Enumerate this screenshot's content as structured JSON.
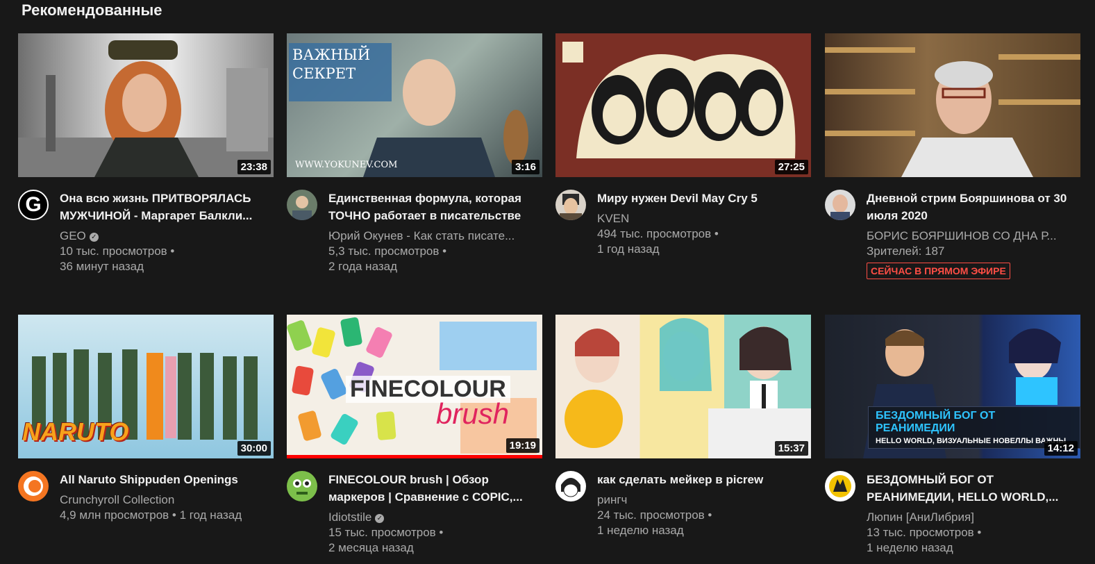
{
  "section": {
    "title": "Рекомендованные"
  },
  "videos": [
    {
      "title": "Она всю жизнь ПРИТВОРЯЛАСЬ МУЖЧИНОЙ - Маргарет Балкли...",
      "channel": "GEO",
      "views": "10 тыс. просмотров •",
      "age": "36 минут назад",
      "duration": "23:38",
      "verified": true,
      "avatar_icon": "G",
      "colors": [
        "#7a7a7a",
        "#cfcfcf",
        "#c2602a"
      ]
    },
    {
      "title": "Единственная формула, которая ТОЧНО работает в писательстве",
      "channel": "Юрий Окунев - Как стать писате...",
      "views": "5,3 тыс. просмотров •",
      "age": "2 года назад",
      "duration": "3:16",
      "thumb_text_1": "ВАЖНЫЙ",
      "thumb_text_2": "СЕКРЕТ",
      "thumb_caption": "WWW.YOKUNEV.COM",
      "colors": [
        "#5d6a6e",
        "#a7b3ad",
        "#2e6d9f"
      ]
    },
    {
      "title": "Миру нужен Devil May Cry 5",
      "channel": "KVEN",
      "views": "494 тыс. просмотров •",
      "age": "1 год назад",
      "duration": "27:25",
      "colors": [
        "#7a2f26",
        "#f2e7c8",
        "#1a1a1a"
      ]
    },
    {
      "title": "Дневной стрим Бояршинова от 30 июля 2020",
      "channel": "БОРИС БОЯРШИНОВ СО ДНА Р...",
      "viewers": "Зрителей: 187",
      "live": "СЕЙЧАС В ПРЯМОМ ЭФИРЕ",
      "colors": [
        "#5b4329",
        "#a57c4c",
        "#e0e0e0"
      ]
    },
    {
      "title": "All Naruto Shippuden Openings",
      "channel": "Crunchyroll Collection",
      "views_age": "4,9 млн просмотров • 1 год назад",
      "duration": "30:00",
      "thumb_logo": "NARUTO",
      "colors": [
        "#8fc7e0",
        "#cfe7f0",
        "#f08a1c"
      ]
    },
    {
      "title": "FINECOLOUR brush | Обзор маркеров | Сравнение с COPIC,...",
      "channel": "Idiotstile",
      "views": "15 тыс. просмотров •",
      "age": "2 месяца назад",
      "duration": "19:19",
      "verified": true,
      "thumb_text_1": "FINECOLOUR",
      "thumb_text_2": "brush",
      "progress": 1.0,
      "colors": [
        "#e84a3c",
        "#2bb673",
        "#f4d03f"
      ]
    },
    {
      "title": "как сделать мейкер в picrew",
      "channel": "рингч",
      "views": "24 тыс. просмотров •",
      "age": "1 неделю назад",
      "duration": "15:37",
      "colors": [
        "#f7e7a0",
        "#8fd3c8",
        "#f4b400"
      ]
    },
    {
      "title": "БЕЗДОМНЫЙ БОГ ОТ РЕАНИМЕДИИ, HELLO WORLD,...",
      "channel": "Люпин [АниЛибрия]",
      "views": "13 тыс. просмотров •",
      "age": "1 неделю назад",
      "duration": "14:12",
      "thumb_text_1": "БЕЗДОМНЫЙ БОГ ОТ РЕАНИМЕДИИ",
      "thumb_text_2": "HELLO WORLD, ВИЗУАЛЬНЫЕ НОВЕЛЛЫ ВАЖНЫ",
      "colors": [
        "#1b2433",
        "#3d7bd9",
        "#2ec4ff"
      ]
    }
  ]
}
